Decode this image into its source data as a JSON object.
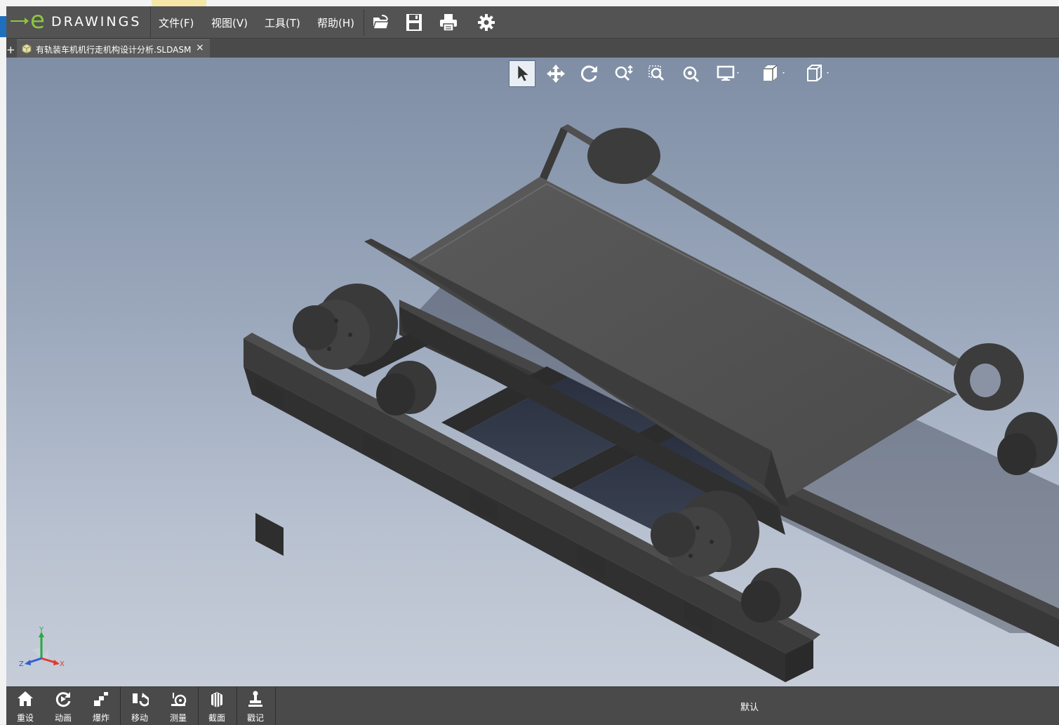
{
  "app": {
    "logo_text": "DRAWINGS",
    "logo_letter": "e",
    "accent_color": "#8cc63f"
  },
  "menu": {
    "file": "文件(F)",
    "view": "视图(V)",
    "tools": "工具(T)",
    "help": "帮助(H)"
  },
  "toolbar_icons": [
    "open-icon",
    "save-icon",
    "print-icon",
    "settings-icon"
  ],
  "tabs": {
    "add_label": "+",
    "document_title": "有轨装车机机行走机构设计分析.SLDASM",
    "close_label": "×"
  },
  "view_tools": [
    "select-icon",
    "pan-icon",
    "rotate-icon",
    "zoom-icon",
    "zoom-to-area-icon",
    "zoom-to-fit-icon",
    "display-style-icon",
    "view-orientation-icon",
    "standard-views-icon"
  ],
  "triad": {
    "x": "X",
    "y": "Y",
    "z": "Z"
  },
  "bottom_tools": [
    {
      "label": "重设",
      "icon": "home-icon"
    },
    {
      "label": "动画",
      "icon": "animate-icon"
    },
    {
      "label": "爆炸",
      "icon": "explode-icon"
    },
    {
      "label": "移动",
      "icon": "move-icon"
    },
    {
      "label": "测量",
      "icon": "measure-icon"
    },
    {
      "label": "截面",
      "icon": "section-icon"
    },
    {
      "label": "戳记",
      "icon": "stamp-icon"
    }
  ],
  "configuration": "默认"
}
